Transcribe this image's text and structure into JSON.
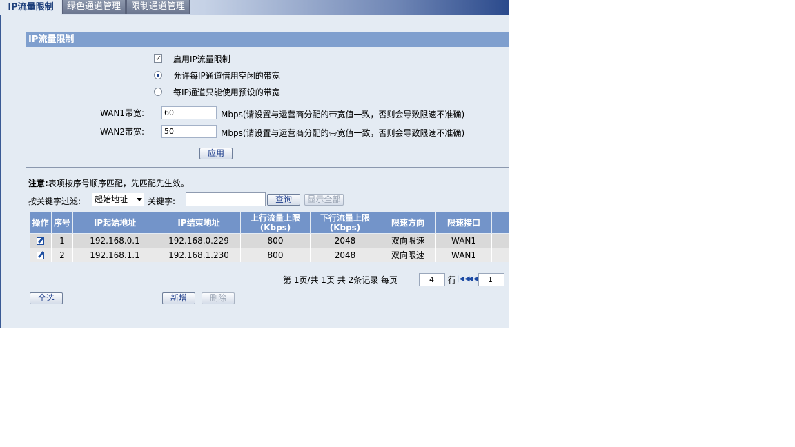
{
  "tabs": [
    {
      "label": "IP流量限制",
      "active": true
    },
    {
      "label": "绿色通道管理",
      "active": false
    },
    {
      "label": "限制通道管理",
      "active": false
    }
  ],
  "section": {
    "title": "IP流量限制"
  },
  "options": {
    "enable_label": "启用IP流量限制",
    "enable_checked": true,
    "borrow_label": "允许每IP通道借用空闲的带宽",
    "borrow_selected": true,
    "preset_label": "每IP通道只能使用预设的带宽",
    "preset_selected": false
  },
  "wan": {
    "wan1_label": "WAN1带宽:",
    "wan1_value": "60",
    "wan2_label": "WAN2带宽:",
    "wan2_value": "50",
    "unit_hint": "Mbps(请设置与运营商分配的带宽值一致，否则会导致限速不准确)"
  },
  "apply_label": "应用",
  "note": {
    "bold": "注意:",
    "text": "表项按序号顺序匹配，先匹配先生效。"
  },
  "filter": {
    "label": "按关键字过滤:",
    "select_value": "起始地址",
    "keyword_label": "关键字:",
    "keyword_value": "",
    "search_label": "查询",
    "show_all_label": "显示全部"
  },
  "table": {
    "headers": [
      "操作",
      "序号",
      "IP起始地址",
      "IP结束地址",
      "上行流量上限 (Kbps)",
      "下行流量上限 (Kbps)",
      "限速方向",
      "限速接口"
    ],
    "rows": [
      {
        "index": "1",
        "start": "192.168.0.1",
        "end": "192.168.0.229",
        "up": "800",
        "down": "2048",
        "dir": "双向限速",
        "iface": "WAN1"
      },
      {
        "index": "2",
        "start": "192.168.1.1",
        "end": "192.168.1.230",
        "up": "800",
        "down": "2048",
        "dir": "双向限速",
        "iface": "WAN1"
      }
    ]
  },
  "pager": {
    "text": "第 1页/共 1页 共 2条记录 每页",
    "per_page": "4",
    "row_unit": "行",
    "page_input": "1"
  },
  "buttons": {
    "select_all": "全选",
    "add": "新增",
    "delete": "删除"
  },
  "colors": {
    "header_bg": "#7394c9",
    "section_bar": "#7f9fce",
    "panel_bg": "#e4ebf3",
    "button_text": "#1b3b8a"
  }
}
